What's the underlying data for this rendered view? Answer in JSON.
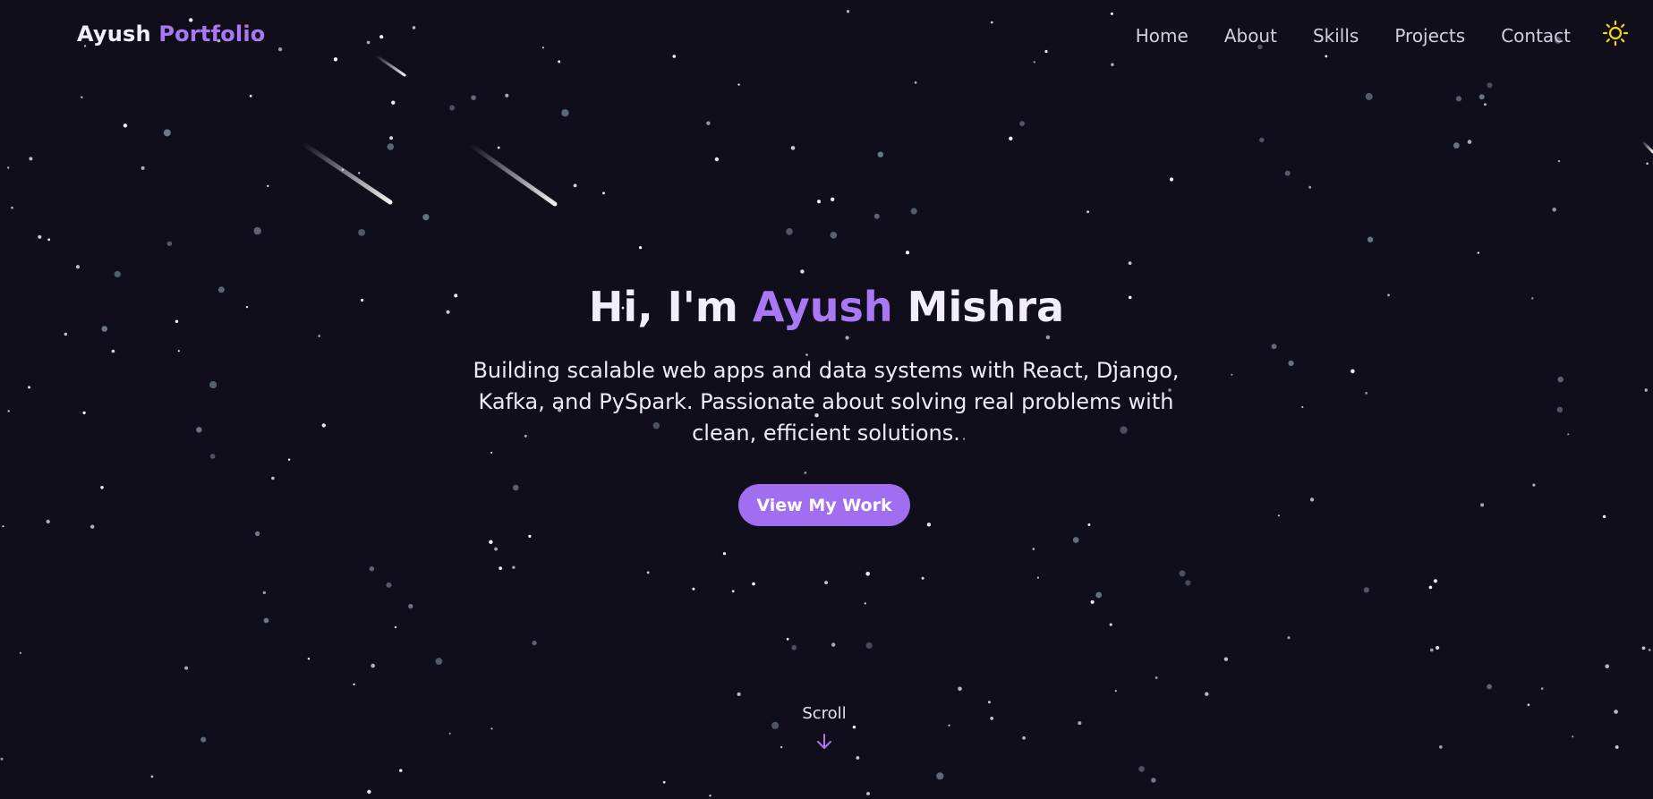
{
  "brand": {
    "name_first": "Ayush",
    "name_second": "Portfolio"
  },
  "nav": {
    "items": [
      {
        "label": "Home"
      },
      {
        "label": "About"
      },
      {
        "label": "Skills"
      },
      {
        "label": "Projects"
      },
      {
        "label": "Contact"
      }
    ],
    "theme_toggle_icon": "sun-icon"
  },
  "hero": {
    "greeting": "Hi, I'm",
    "first_name": "Ayush",
    "last_name": "Mishra",
    "subtitle": "Building scalable web apps and data systems with React, Django, Kafka, and PySpark. Passionate about solving real problems with clean, efficient solutions.",
    "cta_label": "View My Work"
  },
  "scroll": {
    "label": "Scroll",
    "icon": "arrow-down-icon"
  },
  "colors": {
    "background": "#110e1c",
    "accent": "#a878f5",
    "button": "#a16ef2",
    "text": "#f1eefa",
    "sun": "#f5d90a"
  }
}
